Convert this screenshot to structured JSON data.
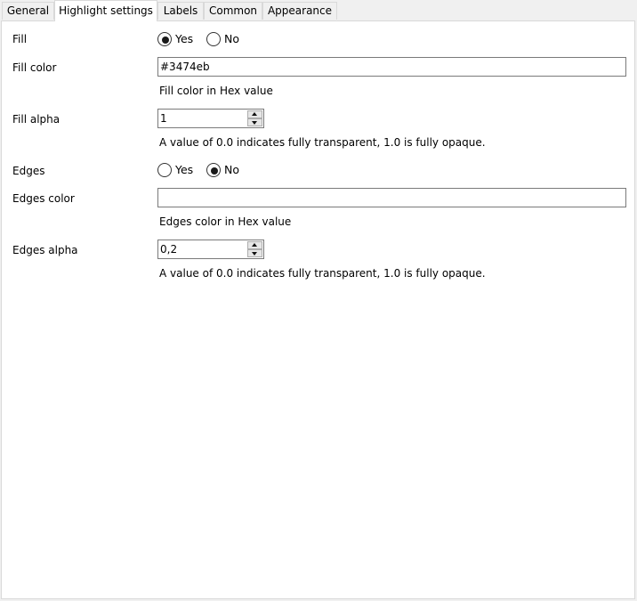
{
  "tabs": [
    {
      "label": "General"
    },
    {
      "label": "Highlight settings",
      "active": true
    },
    {
      "label": "Labels"
    },
    {
      "label": "Common"
    },
    {
      "label": "Appearance"
    }
  ],
  "fill": {
    "label": "Fill",
    "options": [
      {
        "label": "Yes",
        "selected": true
      },
      {
        "label": "No",
        "selected": false
      }
    ]
  },
  "fill_color": {
    "label": "Fill color",
    "value": "#3474eb",
    "hint": "Fill color in Hex value"
  },
  "fill_alpha": {
    "label": "Fill alpha",
    "value": "1",
    "hint": "A value of 0.0 indicates fully transparent, 1.0 is fully opaque."
  },
  "edges": {
    "label": "Edges",
    "options": [
      {
        "label": "Yes",
        "selected": false
      },
      {
        "label": "No",
        "selected": true
      }
    ]
  },
  "edges_color": {
    "label": "Edges color",
    "value": "",
    "hint": "Edges color in Hex value"
  },
  "edges_alpha": {
    "label": "Edges alpha",
    "value": "0,2",
    "hint": "A value of 0.0 indicates fully transparent, 1.0 is fully opaque."
  },
  "colors": {
    "window_bg": "#f0f0f0",
    "panel_bg": "#ffffff",
    "border": "#d9d9d9",
    "input_border": "#7a7a7a"
  }
}
